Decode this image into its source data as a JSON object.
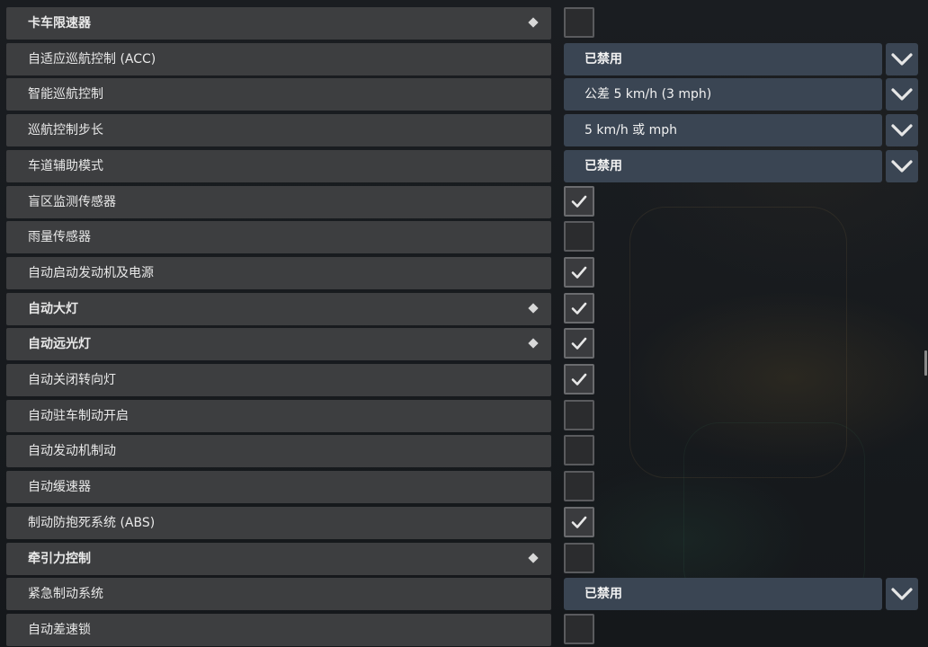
{
  "settings": [
    {
      "label": "卡车限速器",
      "bold": true,
      "diamond": true,
      "control": "checkbox",
      "checked": false
    },
    {
      "label": "自适应巡航控制 (ACC)",
      "bold": false,
      "diamond": false,
      "control": "dropdown",
      "value": "已禁用",
      "value_bold": true
    },
    {
      "label": "智能巡航控制",
      "bold": false,
      "diamond": false,
      "control": "dropdown",
      "value": "公差 5 km/h (3 mph)",
      "value_bold": false
    },
    {
      "label": "巡航控制步长",
      "bold": false,
      "diamond": false,
      "control": "dropdown",
      "value": "5 km/h 或 mph",
      "value_bold": false
    },
    {
      "label": "车道辅助模式",
      "bold": false,
      "diamond": false,
      "control": "dropdown",
      "value": "已禁用",
      "value_bold": true
    },
    {
      "label": "盲区监测传感器",
      "bold": false,
      "diamond": false,
      "control": "checkbox",
      "checked": true
    },
    {
      "label": "雨量传感器",
      "bold": false,
      "diamond": false,
      "control": "checkbox",
      "checked": false
    },
    {
      "label": "自动启动发动机及电源",
      "bold": false,
      "diamond": false,
      "control": "checkbox",
      "checked": true
    },
    {
      "label": "自动大灯",
      "bold": true,
      "diamond": true,
      "control": "checkbox",
      "checked": true
    },
    {
      "label": "自动远光灯",
      "bold": true,
      "diamond": true,
      "control": "checkbox",
      "checked": true
    },
    {
      "label": "自动关闭转向灯",
      "bold": false,
      "diamond": false,
      "control": "checkbox",
      "checked": true
    },
    {
      "label": "自动驻车制动开启",
      "bold": false,
      "diamond": false,
      "control": "checkbox",
      "checked": false
    },
    {
      "label": "自动发动机制动",
      "bold": false,
      "diamond": false,
      "control": "checkbox",
      "checked": false
    },
    {
      "label": "自动缓速器",
      "bold": false,
      "diamond": false,
      "control": "checkbox",
      "checked": false
    },
    {
      "label": "制动防抱死系统 (ABS)",
      "bold": false,
      "diamond": false,
      "control": "checkbox",
      "checked": true
    },
    {
      "label": "牵引力控制",
      "bold": true,
      "diamond": true,
      "control": "checkbox",
      "checked": false
    },
    {
      "label": "紧急制动系统",
      "bold": false,
      "diamond": false,
      "control": "dropdown",
      "value": "已禁用",
      "value_bold": true
    },
    {
      "label": "自动差速锁",
      "bold": false,
      "diamond": false,
      "control": "checkbox",
      "checked": false
    }
  ],
  "icons": {
    "checkmark": "check-icon",
    "dropdown": "chevron-down-icon",
    "marker": "diamond-icon"
  },
  "colors": {
    "row_bg": "#3d3e40",
    "dropdown_bg": "#3a4553",
    "checkbox_border": "#5a5b5e",
    "text": "#e9e9e9"
  }
}
